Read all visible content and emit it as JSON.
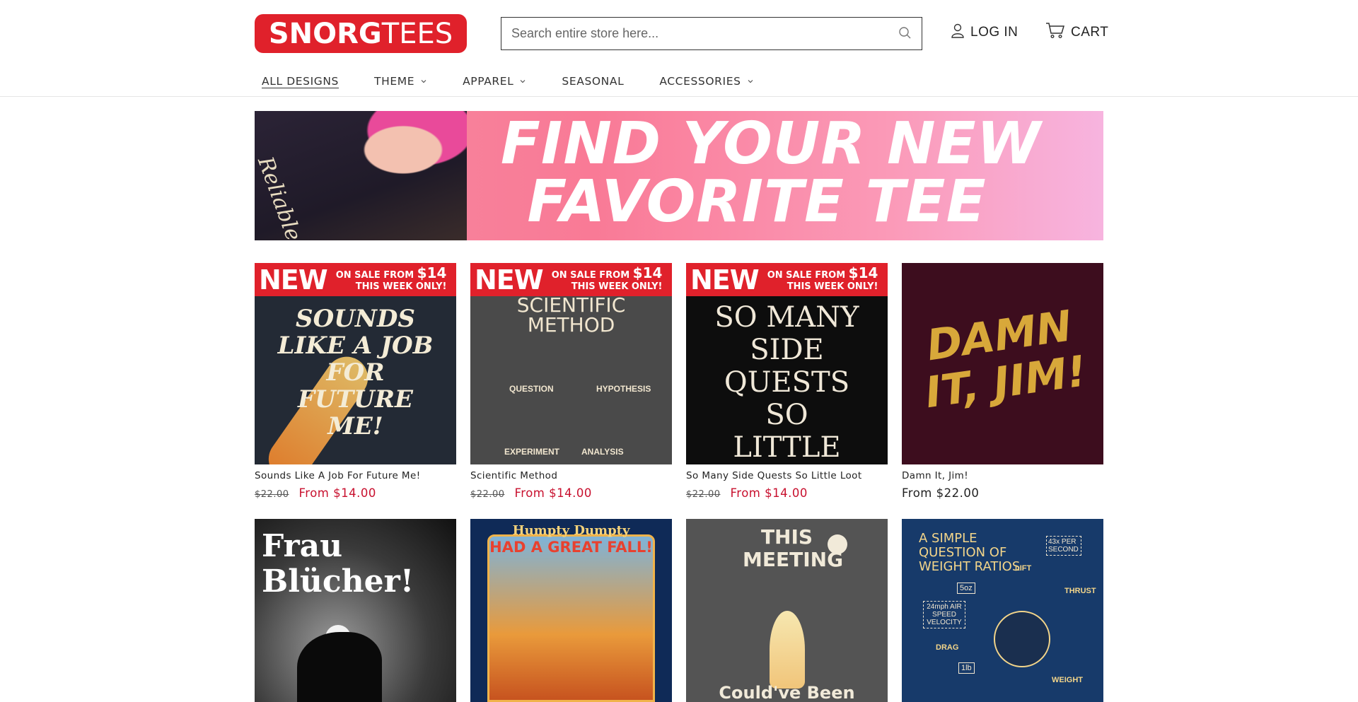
{
  "header": {
    "logo": {
      "part1": "SNORG",
      "part2": "TEES"
    },
    "search": {
      "placeholder": "Search entire store here..."
    },
    "login_label": "LOG IN",
    "cart_label": "CART"
  },
  "nav": {
    "items": [
      {
        "label": "ALL DESIGNS",
        "has_dropdown": false
      },
      {
        "label": "THEME",
        "has_dropdown": true
      },
      {
        "label": "APPAREL",
        "has_dropdown": true
      },
      {
        "label": "SEASONAL",
        "has_dropdown": false
      },
      {
        "label": "ACCESSORIES",
        "has_dropdown": true
      }
    ]
  },
  "banner": {
    "line1": "FIND YOUR NEW",
    "line2": "FAVORITE TEE",
    "shirt_text": "Reliable Narrator"
  },
  "promo": {
    "new": "NEW",
    "line1": "ON SALE FROM",
    "price": "$14",
    "line2": "THIS WEEK ONLY!"
  },
  "products": [
    {
      "name": "Sounds Like A Job For Future Me!",
      "old_price": "$22.00",
      "price": "From $14.00",
      "on_sale": true,
      "art": "SOUNDS LIKE A JOB FOR FUTURE ME!"
    },
    {
      "name": "Scientific Method",
      "old_price": "$22.00",
      "price": "From $14.00",
      "on_sale": true,
      "art": "SCIENTIFIC METHOD",
      "labels": [
        "QUESTION",
        "HYPOTHESIS",
        "EXPERIMENT",
        "ANALYSIS"
      ]
    },
    {
      "name": "So Many Side Quests So Little Loot",
      "old_price": "$22.00",
      "price": "From $14.00",
      "on_sale": true,
      "art": "SO MANY SIDE QUESTS SO LITTLE LOOT"
    },
    {
      "name": "Damn It, Jim!",
      "old_price": "",
      "price": "From $22.00",
      "on_sale": false,
      "art": "DAMN IT, JIM!"
    },
    {
      "name": "",
      "art": "Frau Blücher!"
    },
    {
      "name": "",
      "art_top": "Humpty Dumpty",
      "art": "HAD A GREAT FALL!"
    },
    {
      "name": "",
      "art": "THIS MEETING",
      "art_bottom": "Could've Been"
    },
    {
      "name": "",
      "art": "A SIMPLE QUESTION OF WEIGHT RATIOS",
      "labels": [
        "43x PER SECOND",
        "LIFT",
        "THRUST",
        "5oz",
        "24mph AIR SPEED VELOCITY",
        "DRAG",
        "1lb",
        "WEIGHT"
      ]
    }
  ],
  "colors": {
    "brand_red": "#e0212b",
    "sale_red": "#c8102e",
    "banner_pink": "#f97a96"
  }
}
